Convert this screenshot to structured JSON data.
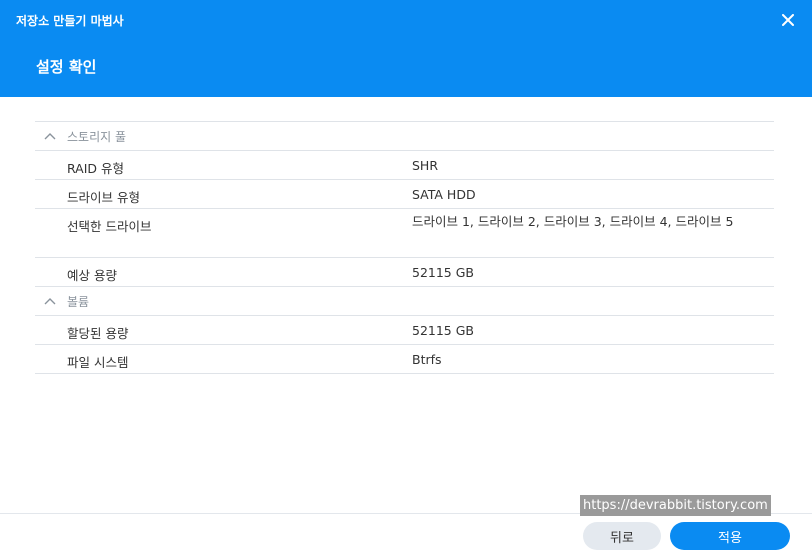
{
  "window": {
    "title": "저장소 만들기 마법사",
    "close_icon": "close-icon"
  },
  "page": {
    "title": "설정 확인"
  },
  "sections": {
    "storage_pool": {
      "label": "스토리지 풀",
      "rows": [
        {
          "key": "RAID 유형",
          "value": "SHR"
        },
        {
          "key": "드라이브 유형",
          "value": "SATA HDD"
        },
        {
          "key": "선택한 드라이브",
          "value": "드라이브 1, 드라이브 2, 드라이브 3, 드라이브 4, 드라이브 5"
        },
        {
          "key": "예상 용량",
          "value": "52115 GB"
        }
      ]
    },
    "volume": {
      "label": "볼륨",
      "rows": [
        {
          "key": "할당된 용량",
          "value": "52115 GB"
        },
        {
          "key": "파일 시스템",
          "value": "Btrfs"
        }
      ]
    }
  },
  "footer": {
    "watermark": "https://devrabbit.tistory.com",
    "back_label": "뒤로",
    "apply_label": "적용"
  },
  "colors": {
    "header": "#0a8bf2",
    "primary_button": "#0a8bf2",
    "secondary_button": "#e4e9ef"
  }
}
